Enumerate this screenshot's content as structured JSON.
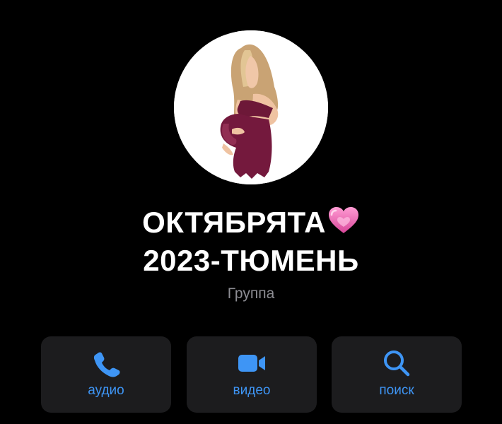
{
  "group": {
    "title_line1": "ОКТЯБРЯТА",
    "title_emoji": "pink-heart-icon",
    "title_line2": "2023-ТЮМЕНЬ",
    "subtitle": "Группа",
    "avatar": "pregnant-woman-illustration"
  },
  "actions": [
    {
      "label": "аудио",
      "icon": "phone-icon"
    },
    {
      "label": "видео",
      "icon": "video-camera-icon"
    },
    {
      "label": "поиск",
      "icon": "search-icon"
    }
  ],
  "colors": {
    "background": "#000000",
    "button_background": "#1c1c1e",
    "accent": "#3e95f5",
    "subtitle": "#8d8d93",
    "heart": "#ef6fb5",
    "dress": "#6d1838"
  }
}
